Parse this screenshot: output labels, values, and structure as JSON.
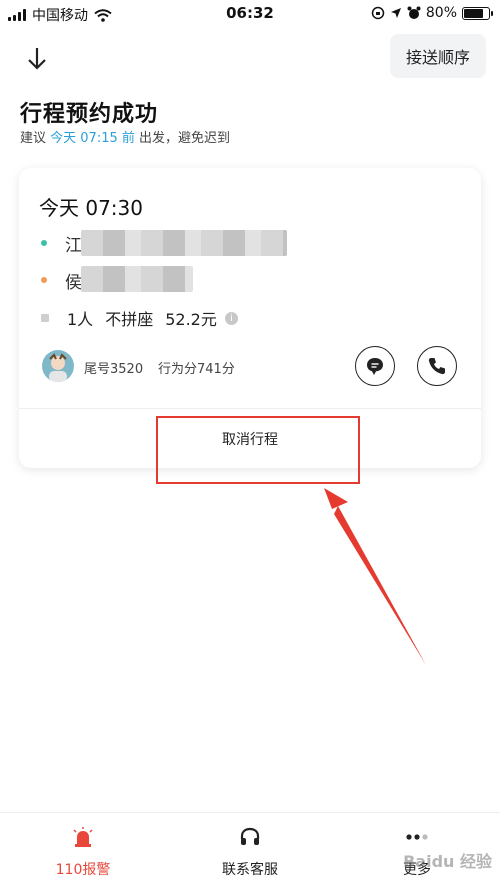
{
  "status_bar": {
    "carrier": "中国移动",
    "time": "06:32",
    "battery": "80%"
  },
  "header": {
    "order_button": "接送顺序",
    "title": "行程预约成功"
  },
  "subtitle": {
    "prefix": "建议",
    "highlight": "今天 07:15 前",
    "suffix": "出发，避免迟到"
  },
  "card": {
    "time": "今天 07:30",
    "start_prefix": "江",
    "end_prefix": "侯",
    "passengers": "1人",
    "carpool": "不拼座",
    "price": "52.2元",
    "driver_plate": "尾号3520",
    "driver_score": "行为分741分",
    "cancel_label": "取消行程"
  },
  "bottom_nav": [
    {
      "label": "110报警",
      "icon": "alarm-light-icon",
      "color": "#e8473a"
    },
    {
      "label": "联系客服",
      "icon": "headset-icon",
      "color": "#222222"
    },
    {
      "label": "更多",
      "icon": "more-dots-icon",
      "color": "#222222"
    }
  ],
  "watermark": "Baidu 经验",
  "colors": {
    "accent": "#2d9fd8",
    "start_dot": "#3bbfa6",
    "end_dot": "#f09a5a",
    "annotation": "#e53a2f"
  }
}
